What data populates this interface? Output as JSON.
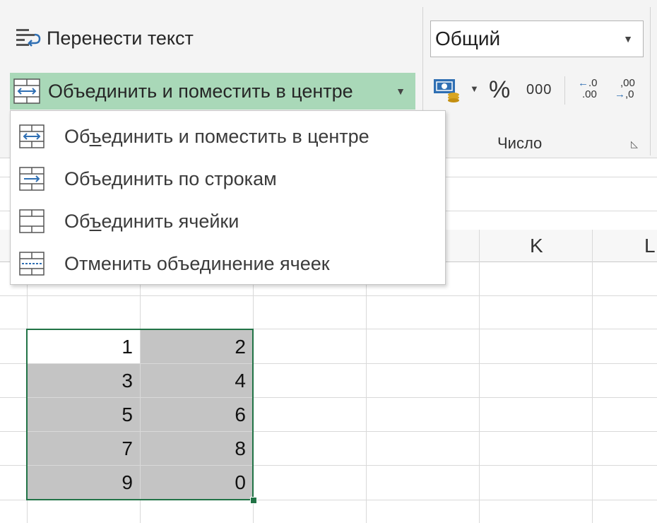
{
  "ribbon": {
    "wrap_text_label": "Перенести текст",
    "merge_button_label": "Объединить и поместить в центре",
    "number_format_value": "Общий",
    "percent_label": "%",
    "thousands_label": "000",
    "increase_decimal": [
      ".0",
      ".00"
    ],
    "decrease_decimal": [
      ",00",
      ",0"
    ],
    "number_group_label": "Число"
  },
  "menu": {
    "items": [
      {
        "pre": "Об",
        "key": "ъ",
        "post": "единить и поместить в центре"
      },
      {
        "pre": "Объе",
        "key": "д",
        "post": "инить по строкам"
      },
      {
        "pre": "Об",
        "key": "ъ",
        "post": "единить ячейки"
      },
      {
        "pre": "Отменить объе",
        "key": "д",
        "post": "инение ячеек"
      }
    ]
  },
  "columns": [
    "K",
    "L"
  ],
  "cells": [
    [
      "1",
      "2"
    ],
    [
      "3",
      "4"
    ],
    [
      "5",
      "6"
    ],
    [
      "7",
      "8"
    ],
    [
      "9",
      "0"
    ]
  ],
  "colors": {
    "accent_green": "#217346",
    "merge_highlight": "#a9d8b8",
    "selection_fill": "#c4c4c4"
  }
}
